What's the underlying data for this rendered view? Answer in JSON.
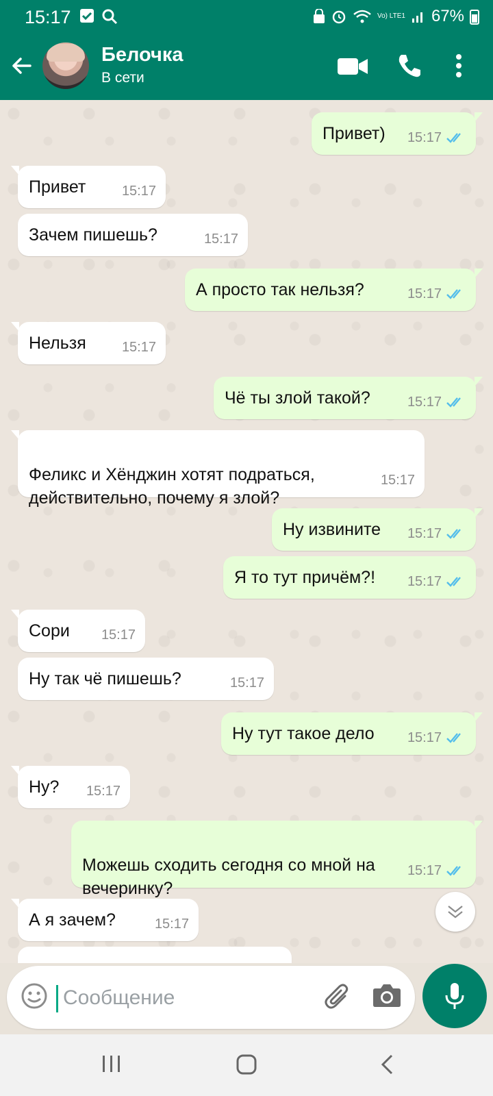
{
  "status_bar": {
    "time": "15:17",
    "network": "Vo) LTE1",
    "battery": "67%"
  },
  "header": {
    "contact_name": "Белочка",
    "contact_status": "В сети"
  },
  "messages": [
    {
      "dir": "out",
      "text": "Привет)",
      "time": "15:17"
    },
    {
      "dir": "in",
      "text": "Привет",
      "time": "15:17"
    },
    {
      "dir": "in",
      "text": "Зачем пишешь?",
      "time": "15:17"
    },
    {
      "dir": "out",
      "text": "А просто так нельзя?",
      "time": "15:17"
    },
    {
      "dir": "in",
      "text": "Нельзя",
      "time": "15:17"
    },
    {
      "dir": "out",
      "text": "Чё ты злой такой?",
      "time": "15:17"
    },
    {
      "dir": "in",
      "text": "Феликс и Хёнджин хотят подраться,\nдействительно, почему я злой?",
      "time": "15:17"
    },
    {
      "dir": "out",
      "text": "Ну извините",
      "time": "15:17"
    },
    {
      "dir": "out",
      "text": "Я то тут причём?!",
      "time": "15:17"
    },
    {
      "dir": "in",
      "text": "Сори",
      "time": "15:17"
    },
    {
      "dir": "in",
      "text": "Ну так чё пишешь?",
      "time": "15:17"
    },
    {
      "dir": "out",
      "text": "Ну тут такое дело",
      "time": "15:17"
    },
    {
      "dir": "in",
      "text": "Ну?",
      "time": "15:17"
    },
    {
      "dir": "out",
      "text": "Можешь сходить сегодня со мной на\nвечеринку?",
      "time": "15:17"
    },
    {
      "dir": "in",
      "text": "А я зачем?",
      "time": "15:17"
    }
  ],
  "composer": {
    "placeholder": "Сообщение"
  },
  "colors": {
    "brand": "#008069",
    "outgoing_bubble": "#e7fed8",
    "incoming_bubble": "#ffffff",
    "read_tick": "#53bdeb"
  },
  "icons": {
    "back": "arrow-left-icon",
    "video": "video-call-icon",
    "call": "phone-icon",
    "menu": "more-vert-icon",
    "emoji": "emoji-icon",
    "attach": "paperclip-icon",
    "camera": "camera-icon",
    "mic": "microphone-icon"
  }
}
